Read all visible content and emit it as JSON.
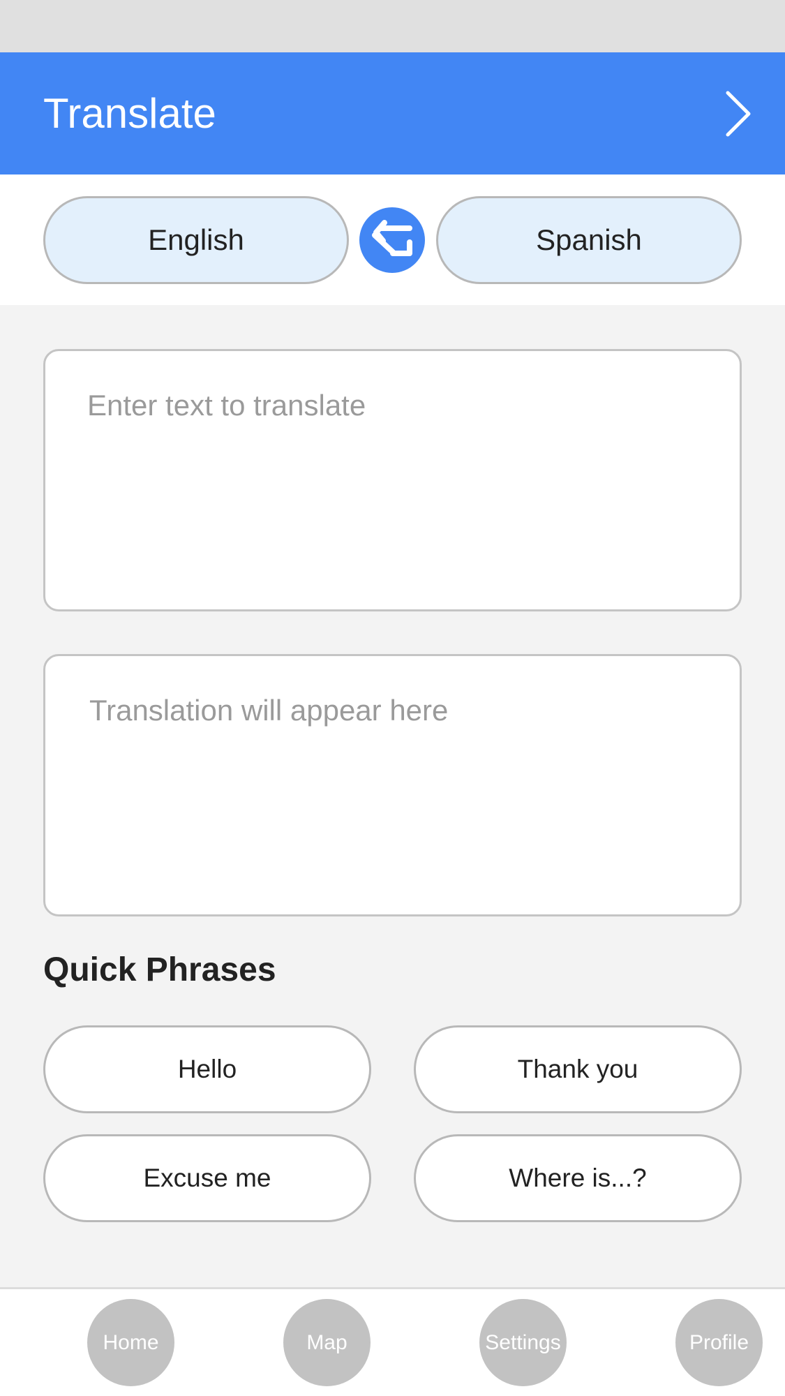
{
  "app_bar": {
    "title": "Translate",
    "forward_icon": "chevron-right-icon"
  },
  "languages": {
    "source": "English",
    "target": "Spanish",
    "swap_icon": "swap-icon"
  },
  "input": {
    "placeholder": "Enter text to translate",
    "value": ""
  },
  "output": {
    "placeholder": "Translation will appear here"
  },
  "quick_phrases": {
    "title": "Quick Phrases",
    "items": [
      "Hello",
      "Thank you",
      "Excuse me",
      "Where is...?"
    ]
  },
  "bottom_nav": {
    "items": [
      "Home",
      "Map",
      "Settings",
      "Profile"
    ]
  },
  "colors": {
    "primary": "#4286f4",
    "language_pill": "#e3f0fc",
    "background": "#f3f3f3",
    "status_bar": "#e0e0e0",
    "nav_inactive": "#c2c2c2",
    "placeholder_text": "#9a9a9a"
  }
}
